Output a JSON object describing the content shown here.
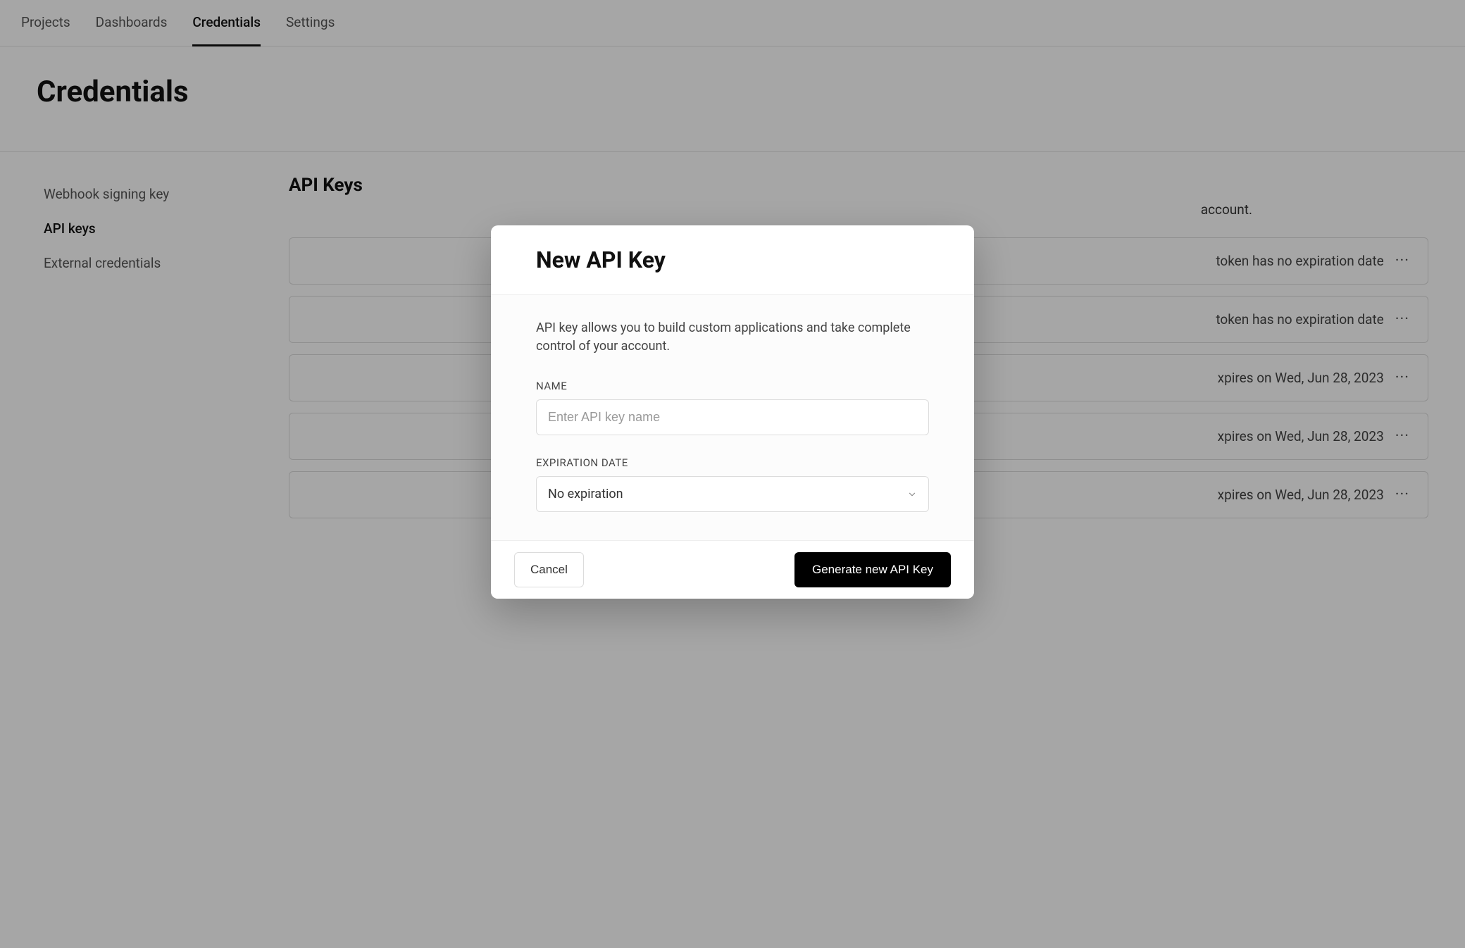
{
  "nav": {
    "items": [
      {
        "label": "Projects"
      },
      {
        "label": "Dashboards"
      },
      {
        "label": "Credentials"
      },
      {
        "label": "Settings"
      }
    ],
    "activeIndex": 2
  },
  "page": {
    "title": "Credentials"
  },
  "sidebar": {
    "items": [
      {
        "label": "Webhook signing key"
      },
      {
        "label": "API keys"
      },
      {
        "label": "External credentials"
      }
    ],
    "activeIndex": 1
  },
  "section": {
    "title": "API Keys",
    "desc_suffix": "account."
  },
  "keys": [
    {
      "expiry_text": "token has no expiration date"
    },
    {
      "expiry_text": "token has no expiration date"
    },
    {
      "expiry_text": "xpires on Wed, Jun 28, 2023"
    },
    {
      "expiry_text": "xpires on Wed, Jun 28, 2023"
    },
    {
      "expiry_text": "xpires on Wed, Jun 28, 2023"
    }
  ],
  "modal": {
    "title": "New API Key",
    "description": "API key allows you to build custom applications and take complete control of your account.",
    "name_label": "NAME",
    "name_placeholder": "Enter API key name",
    "expiration_label": "EXPIRATION DATE",
    "expiration_value": "No expiration",
    "cancel_label": "Cancel",
    "submit_label": "Generate new API Key"
  }
}
